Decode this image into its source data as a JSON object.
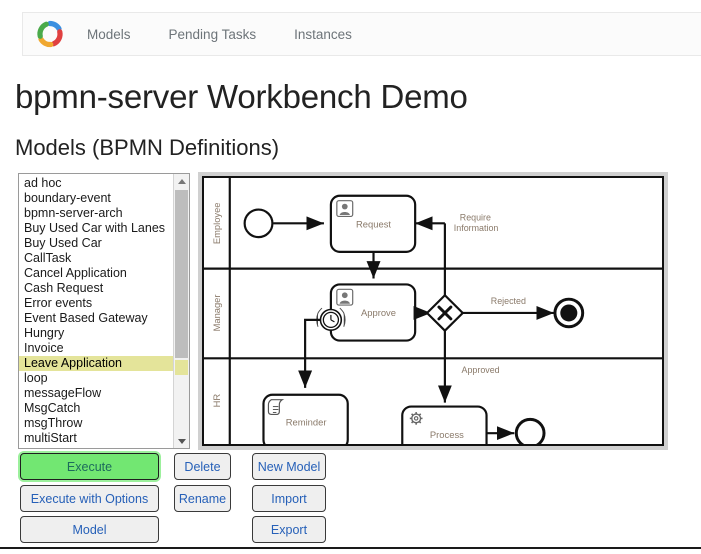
{
  "navbar": {
    "logo_icon": "bpmn-server-logo-icon",
    "logo_colors": [
      "#4aaa4a",
      "#3a8fe0",
      "#e04040",
      "#f0a830"
    ],
    "links": [
      {
        "label": "Models"
      },
      {
        "label": "Pending Tasks"
      },
      {
        "label": "Instances"
      }
    ]
  },
  "page": {
    "title": "bpmn-server Workbench Demo",
    "section_title": "Models (BPMN Definitions)"
  },
  "model_list": {
    "selected": "Leave Application",
    "selection_color": "#e4e49a",
    "items": [
      "ad hoc",
      "boundary-event",
      "bpmn-server-arch",
      "Buy Used Car with Lanes",
      "Buy Used Car",
      "CallTask",
      "Cancel Application",
      "Cash Request",
      "Error events",
      "Event Based Gateway",
      "Hungry",
      "Invoice",
      "Leave Application",
      "loop",
      "messageFlow",
      "MsgCatch",
      "msgThrow",
      "multiStart"
    ],
    "scroll_up_icon": "triangle-up-icon",
    "scroll_down_icon": "triangle-down-icon"
  },
  "buttons": {
    "execute": {
      "label": "Execute",
      "accent": "#72e772"
    },
    "execute_with_options": {
      "label": "Execute with Options"
    },
    "model": {
      "label": "Model"
    },
    "delete": {
      "label": "Delete"
    },
    "rename": {
      "label": "Rename"
    },
    "new_model": {
      "label": "New Model"
    },
    "import": {
      "label": "Import"
    },
    "export": {
      "label": "Export"
    }
  },
  "diagram": {
    "type": "bpmn-collaboration",
    "lanes": [
      "Employee",
      "Manager",
      "HR"
    ],
    "elements": [
      {
        "kind": "start-event",
        "lane": "Employee"
      },
      {
        "kind": "user-task",
        "label": "Request",
        "lane": "Employee"
      },
      {
        "kind": "user-task",
        "label": "Approve",
        "lane": "Manager",
        "boundary": "timer-event"
      },
      {
        "kind": "exclusive-gateway",
        "lane": "Manager"
      },
      {
        "kind": "end-event-terminate",
        "lane": "Manager"
      },
      {
        "kind": "script-task",
        "label": "Reminder",
        "lane": "HR"
      },
      {
        "kind": "service-task",
        "label": "Process",
        "lane": "HR"
      },
      {
        "kind": "end-event",
        "lane": "HR"
      }
    ],
    "flow_labels": [
      {
        "text_line1": "Require",
        "text_line2": "Information"
      },
      {
        "text_line1": "Rejected"
      },
      {
        "text_line1": "Approved"
      }
    ],
    "label_color": "#8a7a6a"
  }
}
